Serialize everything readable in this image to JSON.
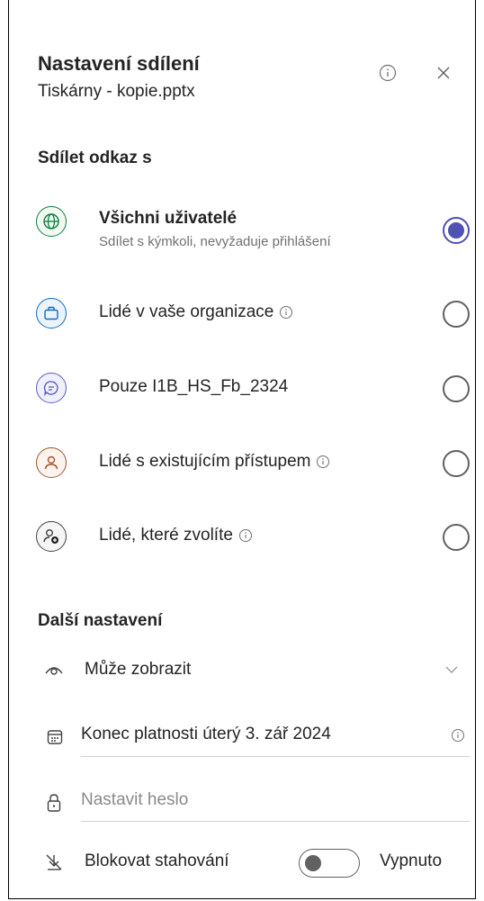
{
  "header": {
    "title": "Nastavení sdílení",
    "filename": "Tiskárny - kopie.pptx",
    "info_icon": "info-icon",
    "close_icon": "close-icon"
  },
  "share_link": {
    "heading": "Sdílet odkaz s",
    "options": [
      {
        "label": "Všichni uživatelé",
        "description": "Sdílet s kýmkoli, nevyžaduje přihlášení",
        "icon": "globe-icon",
        "selected": true,
        "info": false,
        "color": "#107c41"
      },
      {
        "label": "Lidé v vaše organizace",
        "description": "",
        "icon": "briefcase-icon",
        "selected": false,
        "info": true,
        "color": "#0f6cbd"
      },
      {
        "label": "Pouze I1B_HS_Fb_2324",
        "description": "",
        "icon": "chat-icon",
        "selected": false,
        "info": false,
        "color": "#5b5fc7"
      },
      {
        "label": "Lidé s existujícím přístupem",
        "description": "",
        "icon": "person-icon",
        "selected": false,
        "info": true,
        "color": "#a4562c"
      },
      {
        "label": "Lidé, které zvolíte",
        "description": "",
        "icon": "person-add-icon",
        "selected": false,
        "info": true,
        "color": "#424242"
      }
    ]
  },
  "more_settings": {
    "heading": "Další nastavení",
    "permission": {
      "label": "Může zobrazit",
      "icon": "eye-icon",
      "dropdown_icon": "chevron-down-icon"
    },
    "expiration": {
      "label": "Konec platnosti úterý 3. zář 2024",
      "icon": "calendar-icon"
    },
    "password": {
      "placeholder": "Nastavit heslo",
      "icon": "lock-icon"
    },
    "block_download": {
      "label": "Blokovat stahování",
      "state": "Vypnuto",
      "icon": "download-blocked-icon",
      "on": false
    }
  },
  "colors": {
    "accent": "#4f52b2"
  }
}
